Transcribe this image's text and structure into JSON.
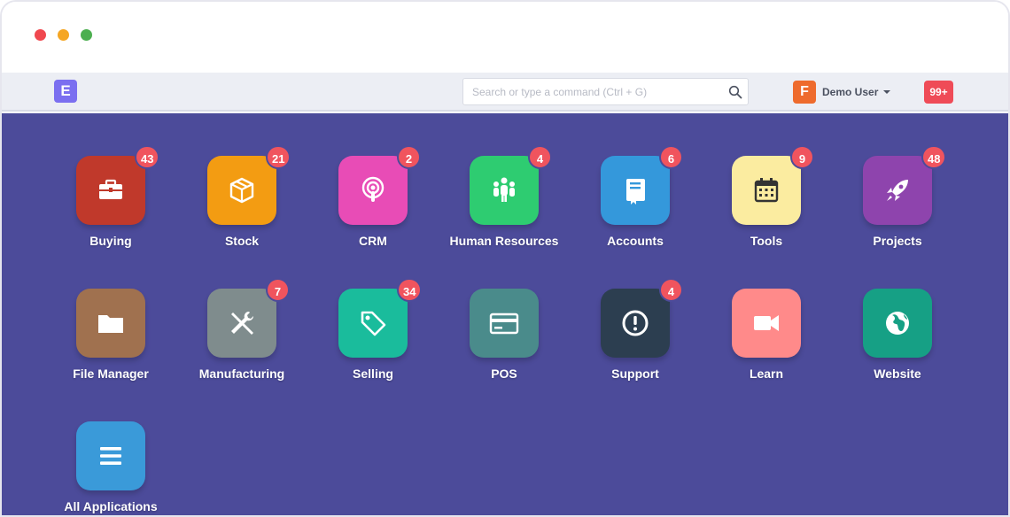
{
  "navbar": {
    "logo_letter": "E",
    "search_placeholder": "Search or type a command (Ctrl + G)",
    "user_initial": "F",
    "user_name": "Demo User",
    "notifications": "99+"
  },
  "apps": [
    {
      "label": "Buying",
      "badge": "43",
      "color": "#c0392b",
      "icon": "briefcase-icon"
    },
    {
      "label": "Stock",
      "badge": "21",
      "color": "#f39c12",
      "icon": "box-icon"
    },
    {
      "label": "CRM",
      "badge": "2",
      "color": "#e84cb6",
      "icon": "podcast-icon"
    },
    {
      "label": "Human Resources",
      "badge": "4",
      "color": "#2ecc71",
      "icon": "people-icon"
    },
    {
      "label": "Accounts",
      "badge": "6",
      "color": "#3498db",
      "icon": "book-icon"
    },
    {
      "label": "Tools",
      "badge": "9",
      "color": "#fbeca0",
      "icon": "calendar-icon"
    },
    {
      "label": "Projects",
      "badge": "48",
      "color": "#8e44ad",
      "icon": "rocket-icon"
    },
    {
      "label": "File Manager",
      "badge": "",
      "color": "#a0714f",
      "icon": "folder-icon"
    },
    {
      "label": "Manufacturing",
      "badge": "7",
      "color": "#7f8c8d",
      "icon": "tools-icon"
    },
    {
      "label": "Selling",
      "badge": "34",
      "color": "#1abc9c",
      "icon": "tag-icon"
    },
    {
      "label": "POS",
      "badge": "",
      "color": "#4a8b8b",
      "icon": "card-icon"
    },
    {
      "label": "Support",
      "badge": "4",
      "color": "#2c3e50",
      "icon": "alert-icon"
    },
    {
      "label": "Learn",
      "badge": "",
      "color": "#ff8a8a",
      "icon": "video-icon"
    },
    {
      "label": "Website",
      "badge": "",
      "color": "#16a085",
      "icon": "globe-icon"
    },
    {
      "label": "All Applications",
      "badge": "",
      "color": "#3a9ad9",
      "icon": "menu-icon"
    }
  ]
}
